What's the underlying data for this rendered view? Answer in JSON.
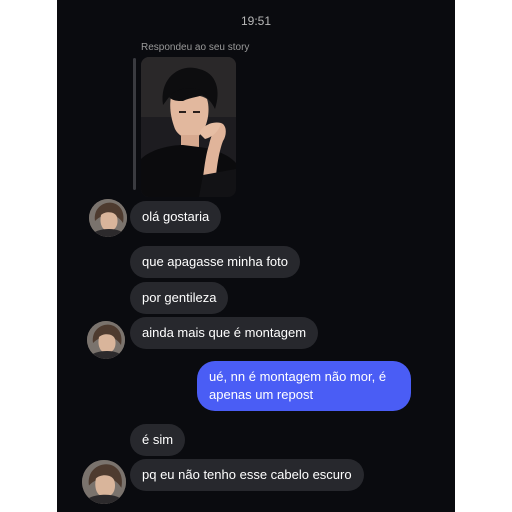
{
  "status": {
    "time": "19:51"
  },
  "story_reply": {
    "label": "Respondeu ao seu story"
  },
  "messages": [
    {
      "text": "olá gostaria",
      "from": "them"
    },
    {
      "text": "que apagasse minha foto",
      "from": "them"
    },
    {
      "text": "por gentileza",
      "from": "them"
    },
    {
      "text": "ainda mais que é montagem",
      "from": "them"
    },
    {
      "text": "ué, nn é montagem não mor, é apenas um repost",
      "from": "me"
    },
    {
      "text": "é sim",
      "from": "them"
    },
    {
      "text": "pq eu não tenho esse cabelo escuro",
      "from": "them"
    }
  ],
  "colors": {
    "background": "#0a0b0f",
    "received_bubble": "#27282d",
    "sent_bubble": "#4a5df5"
  }
}
